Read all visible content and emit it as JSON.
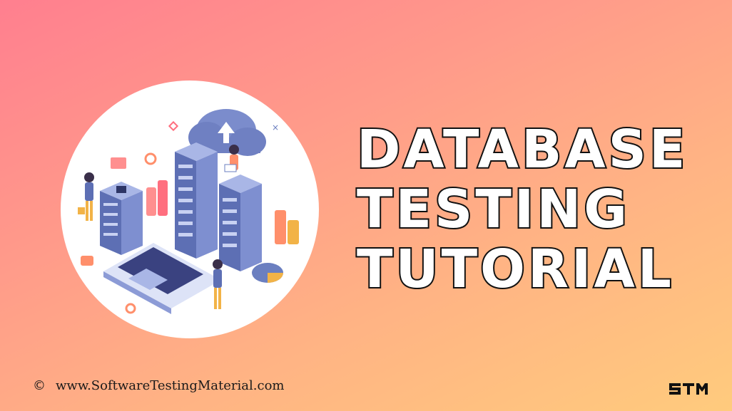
{
  "title": {
    "lines": [
      "DATABASE",
      "TESTING",
      "TUTORIAL"
    ]
  },
  "footer": {
    "copyright_symbol": "©",
    "website": "www.SoftwareTestingMaterial.com"
  },
  "logo": {
    "text": "STM"
  },
  "colors": {
    "gradient_start": "#ff7f8f",
    "gradient_end": "#ffcb7d",
    "title_fill": "#ffffff",
    "title_stroke": "#111111",
    "server_blue": "#6b7fc0",
    "accent_orange": "#ff9a5a"
  },
  "illustration": {
    "description_icon": "database-servers-cloud-illustration"
  }
}
